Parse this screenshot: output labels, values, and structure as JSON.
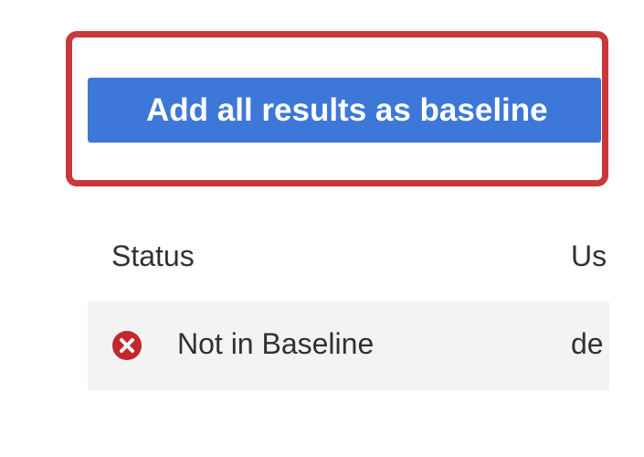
{
  "toolbar": {
    "add_baseline_label": "Add all results as baseline"
  },
  "table": {
    "columns": [
      "Status",
      "Us"
    ],
    "rows": [
      {
        "status_icon": "error-circle-icon",
        "status": "Not in Baseline",
        "user": "de"
      }
    ]
  },
  "colors": {
    "highlight": "#c9393a",
    "primary": "#3d78d8",
    "error": "#c1272d",
    "row_background": "#f3f3f3"
  }
}
